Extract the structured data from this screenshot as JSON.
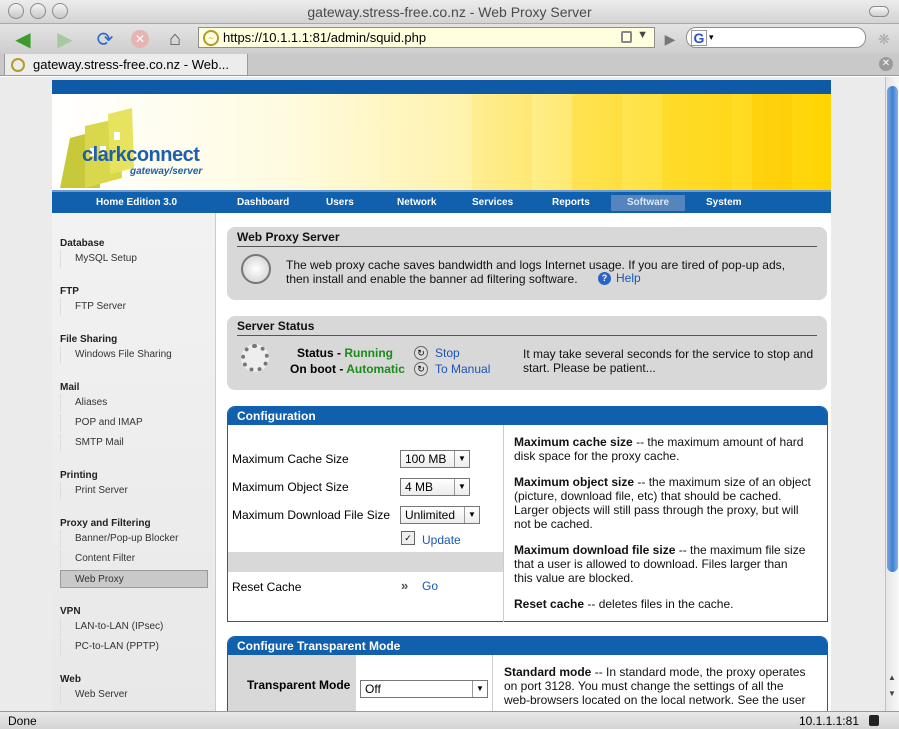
{
  "window": {
    "title": "gateway.stress-free.co.nz - Web Proxy Server"
  },
  "toolbar": {
    "url": "https://10.1.1.1:81/admin/squid.php",
    "search_placeholder": ""
  },
  "tab": {
    "title": "gateway.stress-free.co.nz - Web..."
  },
  "status": {
    "left": "Done",
    "right": "10.1.1.1:81"
  },
  "logo": {
    "name": "clarkconnect",
    "sub": "gateway/server"
  },
  "nav": [
    "Home Edition 3.0",
    "Dashboard",
    "Users",
    "Network",
    "Services",
    "Reports",
    "Software",
    "System"
  ],
  "sidebar": {
    "sections": [
      {
        "heading": "Database",
        "items": [
          "MySQL Setup"
        ]
      },
      {
        "heading": "FTP",
        "items": [
          "FTP Server"
        ]
      },
      {
        "heading": "File Sharing",
        "items": [
          "Windows File Sharing"
        ]
      },
      {
        "heading": "Mail",
        "items": [
          "Aliases",
          "POP and IMAP",
          "SMTP Mail"
        ]
      },
      {
        "heading": "Printing",
        "items": [
          "Print Server"
        ]
      },
      {
        "heading": "Proxy and Filtering",
        "items": [
          "Banner/Pop-up Blocker",
          "Content Filter",
          "Web Proxy"
        ]
      },
      {
        "heading": "VPN",
        "items": [
          "LAN-to-LAN (IPsec)",
          "PC-to-LAN (PPTP)"
        ]
      },
      {
        "heading": "Web",
        "items": [
          "Web Server"
        ]
      }
    ]
  },
  "info": {
    "heading": "Web Proxy Server",
    "line1": "The web proxy cache saves bandwidth and logs Internet usage.  If you are tired of pop-up ads,",
    "line2": "then install and enable the banner ad filtering software.",
    "help": "Help"
  },
  "server": {
    "heading": "Server Status",
    "status_label": "Status - ",
    "status_value": "Running",
    "boot_label": "On boot - ",
    "boot_value": "Automatic",
    "stop": "Stop",
    "manual": "To Manual",
    "note1": "It may take several seconds for the service to stop and",
    "note2": "start.  Please be patient..."
  },
  "config": {
    "heading": "Configuration",
    "cache_label": "Maximum Cache Size",
    "cache_value": "100 MB",
    "object_label": "Maximum Object Size",
    "object_value": "4 MB",
    "download_label": "Maximum Download File Size",
    "download_value": "Unlimited",
    "update": "Update",
    "reset_label": "Reset Cache",
    "go": "Go",
    "help1_bold": "Maximum cache size",
    "help1a": " -- the maximum amount of hard",
    "help1b": "disk space for the proxy cache.",
    "help2_bold": "Maximum object size",
    "help2a": " -- the maximum size of an object",
    "help2b": "(picture, download file, etc) that should be cached.",
    "help2c": "Larger objects will still pass through the proxy, but will",
    "help2d": "not be cached.",
    "help3_bold": "Maximum download file size",
    "help3a": " -- the maximum file size",
    "help3b": "that a user is allowed to download.  Files larger than",
    "help3c": "this value are blocked.",
    "help4_bold": "Reset cache",
    "help4a": " -- deletes files in the cache."
  },
  "transparent": {
    "heading": "Configure Transparent Mode",
    "label": "Transparent Mode",
    "value": "Off",
    "help_bold": "Standard mode",
    "help1": " -- In standard mode, the proxy operates",
    "help2": "on port 3128.  You must change the settings of all the",
    "help3": "web-browsers located on the local network.  See the user"
  }
}
